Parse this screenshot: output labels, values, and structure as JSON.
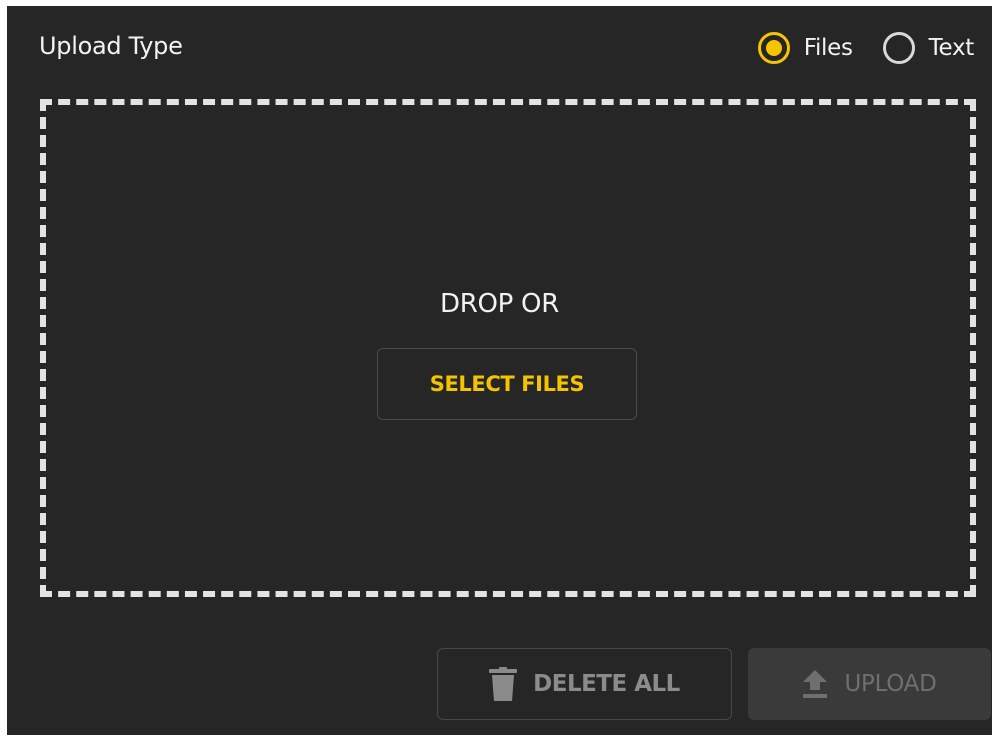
{
  "upload_type": {
    "label": "Upload Type",
    "options": [
      {
        "label": "Files",
        "selected": true
      },
      {
        "label": "Text",
        "selected": false
      }
    ]
  },
  "dropzone": {
    "prompt": "DROP OR",
    "select_button": "SELECT FILES"
  },
  "actions": {
    "delete_all": {
      "label": "DELETE ALL",
      "icon": "trash-icon",
      "disabled": true
    },
    "upload": {
      "label": "UPLOAD",
      "icon": "upload-arrow-icon",
      "disabled": true
    }
  },
  "colors": {
    "background": "#262626",
    "accent": "#f5c400",
    "text": "#f2f2f2",
    "disabled_text": "#8b8b8b"
  }
}
